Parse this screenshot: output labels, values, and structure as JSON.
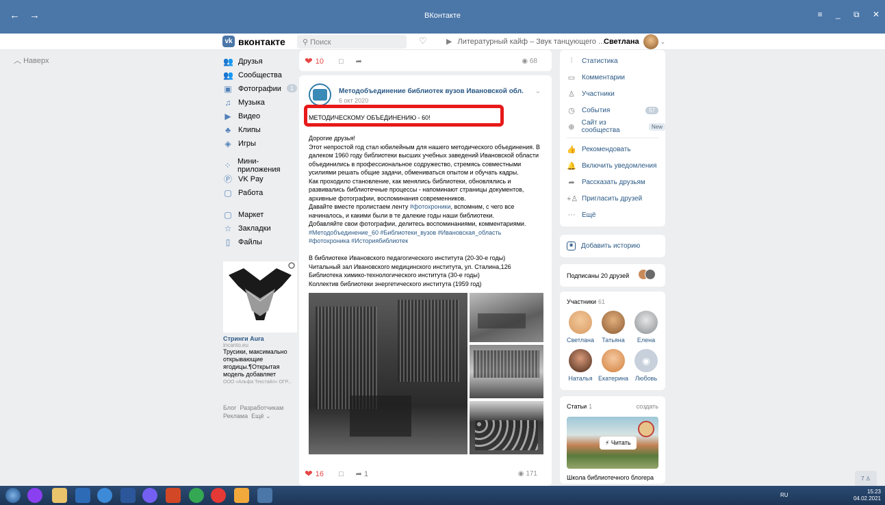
{
  "window": {
    "title": "ВКонтакте",
    "back": "←",
    "forward": "→",
    "controls": [
      "≡",
      "_",
      "⧉",
      "✕"
    ]
  },
  "header": {
    "logo_letter": "vk",
    "logo_text": "вконтакте",
    "search_placeholder": "Поиск",
    "player_text": "Литературный кайф – Звук танцующего ...",
    "user_name": "Светлана"
  },
  "nav_up": "Наверх",
  "left_menu": [
    {
      "label": "Друзья",
      "icon": "friends-icon",
      "glyph": "👥"
    },
    {
      "label": "Сообщества",
      "icon": "communities-icon",
      "glyph": "👥"
    },
    {
      "label": "Фотографии",
      "icon": "photos-icon",
      "glyph": "▣",
      "count": "1"
    },
    {
      "label": "Музыка",
      "icon": "music-icon",
      "glyph": "♫"
    },
    {
      "label": "Видео",
      "icon": "video-icon",
      "glyph": "▶"
    },
    {
      "label": "Клипы",
      "icon": "clips-icon",
      "glyph": "♣"
    },
    {
      "label": "Игры",
      "icon": "games-icon",
      "glyph": "◈"
    },
    {
      "label": "Мини-приложения",
      "icon": "mini-apps-icon",
      "glyph": "⁘"
    },
    {
      "label": "VK Pay",
      "icon": "vkpay-icon",
      "glyph": "Ⓟ"
    },
    {
      "label": "Работа",
      "icon": "work-icon",
      "glyph": "▢"
    },
    {
      "label": "Маркет",
      "icon": "market-icon",
      "glyph": "▢"
    },
    {
      "label": "Закладки",
      "icon": "bookmarks-icon",
      "glyph": "☆"
    },
    {
      "label": "Файлы",
      "icon": "files-icon",
      "glyph": "▯"
    }
  ],
  "ad": {
    "title": "Стринги Aura",
    "domain": "incanto.eu",
    "text_lines": [
      "Трусики, максимально",
      "открывающие",
      "ягодицы.¶Открытая",
      "модель добавляет"
    ],
    "org": "ООО «Альфа Текстайл» ОГР..."
  },
  "footer_links": {
    "blog": "Блог",
    "dev": "Разработчикам",
    "ads": "Реклама",
    "more": "Ещё ⌄"
  },
  "prev_post": {
    "likes": "10",
    "views": "68"
  },
  "post": {
    "author": "Методобъединение библиотек вузов Ивановской обл.",
    "date": "6 окт 2020",
    "headline": "МЕТОДИЧЕСКОМУ ОБЪЕДИНЕНИЮ - 60!",
    "lines": [
      "Дорогие друзья!",
      "Этот непростой год стал юбилейным для нашего методического объединения. В",
      "далеком 1960 году библиотеки высших учебных заведений Ивановской области",
      "объединились в профессиональное содружество, стремясь совместными",
      "усилиями решать общие задачи, обмениваться опытом и обучать кадры.",
      "Как проходило становление, как менялись библиотеки, обновлялись и",
      "развивались библиотечные процессы - напоминают страницы документов,",
      "архивные фотографии, воспоминания современников."
    ],
    "line_tape_pre": "Давайте вместе пролистаем ленту ",
    "line_tape_tag": "#фотохроники",
    "line_tape_post": ", вспомним, с чего все",
    "lines2": [
      "начиналось, и какими были в те далекие годы наши библиотеки.",
      "Добавляйте свои фотографии, делитесь воспоминаниями, комментариями."
    ],
    "tags1": "#Методобъединение_60 #Библиотеки_вузов #Ивановская_область",
    "tags2": "#фотохроника #Историябиблиотек",
    "captions": [
      "В библиотеке Ивановского педагогического института (20-30-е годы)",
      "Читальный зал Ивановского медицинского института, ул. Сталина,126",
      "Библиотека химико-технологического института (30-е годы)",
      "Коллектив библиотеки энергетического института (1959 год)"
    ],
    "likes": "16",
    "shares": "1",
    "views": "171"
  },
  "right_menu": [
    {
      "label": "Статистика",
      "icon": "stats-icon",
      "glyph": "⫶"
    },
    {
      "label": "Комментарии",
      "icon": "comments-icon",
      "glyph": "▭"
    },
    {
      "label": "Участники",
      "icon": "members-icon",
      "glyph": "♙"
    },
    {
      "label": "События",
      "icon": "events-icon",
      "glyph": "◷",
      "badge": "57"
    },
    {
      "label": "Сайт из сообщества",
      "icon": "globe-icon",
      "glyph": "⊕",
      "new": "New"
    }
  ],
  "right_menu2": [
    {
      "label": "Рекомендовать",
      "icon": "thumbs-up-icon",
      "glyph": "👍"
    },
    {
      "label": "Включить уведомления",
      "icon": "bell-icon",
      "glyph": "🔔"
    },
    {
      "label": "Рассказать друзьям",
      "icon": "share-icon",
      "glyph": "➦"
    },
    {
      "label": "Пригласить друзей",
      "icon": "invite-icon",
      "glyph": "+♙"
    },
    {
      "label": "Ещё",
      "icon": "more-icon",
      "glyph": "···"
    }
  ],
  "story": {
    "label": "Добавить историю"
  },
  "subscribed": "Подписаны 20 друзей",
  "members": {
    "title": "Участники",
    "count": "61",
    "list": [
      {
        "name": "Светлана",
        "color": "#d89a62"
      },
      {
        "name": "Татьяна",
        "color": "#b07a4a"
      },
      {
        "name": "Елена",
        "color": "#9aa3a8"
      },
      {
        "name": "Наталья",
        "color": "#6b3b2b"
      },
      {
        "name": "Екатерина",
        "color": "#e0a070"
      },
      {
        "name": "Любовь",
        "color": "#c7d0db"
      }
    ]
  },
  "articles": {
    "title": "Статьи",
    "count": "1",
    "create": "создать",
    "read": "Читать",
    "article_title": "Школа библиотечного блогера"
  },
  "scroll_badge": "7",
  "taskbar": {
    "lang": "RU",
    "time": "15:23",
    "date": "04.02.2021"
  }
}
